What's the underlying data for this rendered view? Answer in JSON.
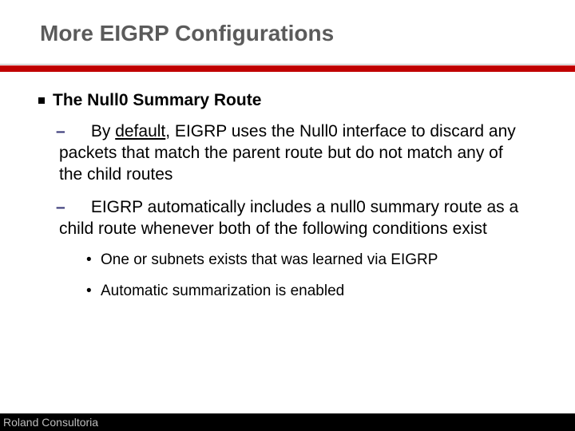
{
  "title": "More EIGRP Configurations",
  "section_heading": "The Null0 Summary Route",
  "sub1_lead": "By",
  "sub1_underlined": "default",
  "sub1_rest": ", EIGRP uses the Null0 interface to discard any packets that match the parent route but do not match any of the child routes",
  "sub2": "EIGRP automatically includes a null0 summary route as a child route whenever both of the following conditions exist",
  "dot1": "One or subnets exists that was learned via EIGRP",
  "dot2": "Automatic summarization is enabled",
  "footer": "Roland Consultoria"
}
